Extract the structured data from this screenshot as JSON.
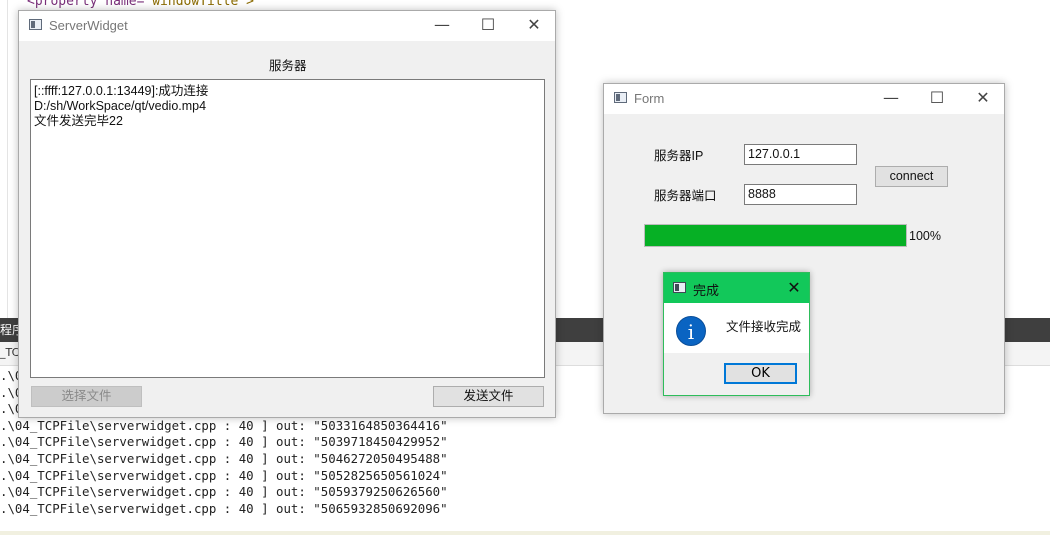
{
  "background_ide": {
    "code_line_prefix": "<property name=",
    "code_line_value": "\"windowTitle\">",
    "output_panel_label": "程序",
    "output_tab_label": "_TC",
    "output_lines": [
      ".\\0",
      ".\\0",
      ".\\0",
      ".\\04_TCPFile\\serverwidget.cpp : 40 ] out: \"5033164850364416\"",
      ".\\04_TCPFile\\serverwidget.cpp : 40 ] out: \"5039718450429952\"",
      ".\\04_TCPFile\\serverwidget.cpp : 40 ] out: \"5046272050495488\"",
      ".\\04_TCPFile\\serverwidget.cpp : 40 ] out: \"5052825650561024\"",
      ".\\04_TCPFile\\serverwidget.cpp : 40 ] out: \"5059379250626560\"",
      ".\\04_TCPFile\\serverwidget.cpp : 40 ] out: \"5065932850692096\""
    ]
  },
  "server_window": {
    "title": "ServerWidget",
    "minimize_glyph": "—",
    "maximize_glyph": "☐",
    "close_glyph": "✕",
    "heading": "服务器",
    "log_lines": [
      "[::ffff:127.0.0.1:13449]:成功连接",
      "D:/sh/WorkSpace/qt/vedio.mp4",
      "文件发送完毕22"
    ],
    "select_file_button": "选择文件",
    "send_file_button": "发送文件"
  },
  "form_window": {
    "title": "Form",
    "minimize_glyph": "—",
    "maximize_glyph": "☐",
    "close_glyph": "✕",
    "ip_label": "服务器IP",
    "ip_value": "127.0.0.1",
    "port_label": "服务器端口",
    "port_value": "8888",
    "connect_button": "connect",
    "progress_value": 1.0,
    "progress_text": "100%",
    "progress_color": "#06b025"
  },
  "dialog": {
    "title": "完成",
    "close_glyph": "✕",
    "icon": "info-icon",
    "icon_glyph": "i",
    "message": "文件接收完成",
    "ok_button": "OK",
    "title_color": "#12c85a"
  }
}
